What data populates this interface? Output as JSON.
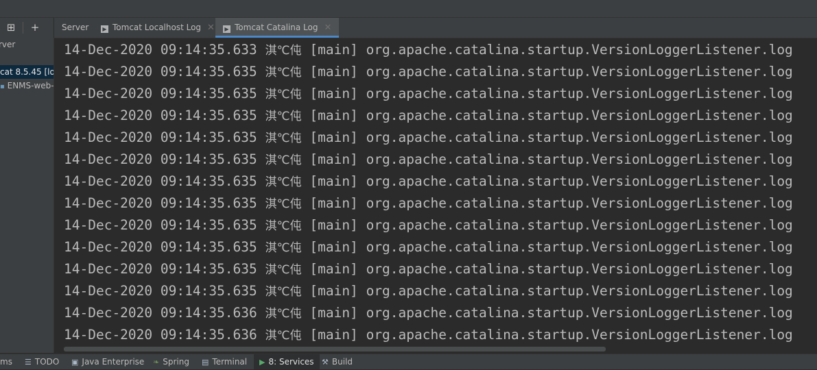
{
  "side_toolbar": {
    "layout_icon": "layout-icon",
    "add_icon": "add-icon"
  },
  "tree": [
    {
      "label": "rver",
      "selected": false
    },
    {
      "label": "cat 8.5.45 [lo",
      "selected": true
    },
    {
      "label": "ENMS-web-",
      "selected": false,
      "icon": "artifact-icon"
    }
  ],
  "tabs": [
    {
      "label": "Server",
      "icon": "",
      "closable": false,
      "active": false
    },
    {
      "label": "Tomcat Localhost Log",
      "icon": "console-icon",
      "closable": true,
      "active": false
    },
    {
      "label": "Tomcat Catalina Log",
      "icon": "console-icon",
      "closable": true,
      "active": true
    }
  ],
  "log": {
    "lines": [
      {
        "date": "14-Dec-2020",
        "time": "09:14:35.633",
        "level": "淇℃伅",
        "thread": "[main]",
        "logger": "org.apache.catalina.startup.VersionLoggerListener.log"
      },
      {
        "date": "14-Dec-2020",
        "time": "09:14:35.635",
        "level": "淇℃伅",
        "thread": "[main]",
        "logger": "org.apache.catalina.startup.VersionLoggerListener.log"
      },
      {
        "date": "14-Dec-2020",
        "time": "09:14:35.635",
        "level": "淇℃伅",
        "thread": "[main]",
        "logger": "org.apache.catalina.startup.VersionLoggerListener.log"
      },
      {
        "date": "14-Dec-2020",
        "time": "09:14:35.635",
        "level": "淇℃伅",
        "thread": "[main]",
        "logger": "org.apache.catalina.startup.VersionLoggerListener.log"
      },
      {
        "date": "14-Dec-2020",
        "time": "09:14:35.635",
        "level": "淇℃伅",
        "thread": "[main]",
        "logger": "org.apache.catalina.startup.VersionLoggerListener.log"
      },
      {
        "date": "14-Dec-2020",
        "time": "09:14:35.635",
        "level": "淇℃伅",
        "thread": "[main]",
        "logger": "org.apache.catalina.startup.VersionLoggerListener.log"
      },
      {
        "date": "14-Dec-2020",
        "time": "09:14:35.635",
        "level": "淇℃伅",
        "thread": "[main]",
        "logger": "org.apache.catalina.startup.VersionLoggerListener.log"
      },
      {
        "date": "14-Dec-2020",
        "time": "09:14:35.635",
        "level": "淇℃伅",
        "thread": "[main]",
        "logger": "org.apache.catalina.startup.VersionLoggerListener.log"
      },
      {
        "date": "14-Dec-2020",
        "time": "09:14:35.635",
        "level": "淇℃伅",
        "thread": "[main]",
        "logger": "org.apache.catalina.startup.VersionLoggerListener.log"
      },
      {
        "date": "14-Dec-2020",
        "time": "09:14:35.635",
        "level": "淇℃伅",
        "thread": "[main]",
        "logger": "org.apache.catalina.startup.VersionLoggerListener.log"
      },
      {
        "date": "14-Dec-2020",
        "time": "09:14:35.635",
        "level": "淇℃伅",
        "thread": "[main]",
        "logger": "org.apache.catalina.startup.VersionLoggerListener.log"
      },
      {
        "date": "14-Dec-2020",
        "time": "09:14:35.635",
        "level": "淇℃伅",
        "thread": "[main]",
        "logger": "org.apache.catalina.startup.VersionLoggerListener.log"
      },
      {
        "date": "14-Dec-2020",
        "time": "09:14:35.636",
        "level": "淇℃伅",
        "thread": "[main]",
        "logger": "org.apache.catalina.startup.VersionLoggerListener.log"
      },
      {
        "date": "14-Dec-2020",
        "time": "09:14:35.636",
        "level": "淇℃伅",
        "thread": "[main]",
        "logger": "org.apache.catalina.startup.VersionLoggerListener.log"
      }
    ]
  },
  "bottom_tabs": [
    {
      "label": "ms",
      "icon": "",
      "active": false
    },
    {
      "label": "TODO",
      "icon": "todo-icon",
      "active": false
    },
    {
      "label": "Java Enterprise",
      "icon": "java-enterprise-icon",
      "active": false
    },
    {
      "label": "Spring",
      "icon": "spring-icon",
      "active": false
    },
    {
      "label": "Terminal",
      "icon": "terminal-icon",
      "active": false
    },
    {
      "label": "8: Services",
      "icon": "services-icon",
      "active": true
    },
    {
      "label": "Build",
      "icon": "build-icon",
      "active": false
    }
  ],
  "colors": {
    "background": "#2b2b2b",
    "panel": "#3c3f41",
    "text": "#bbbbbb",
    "accent": "#4a88c7",
    "selection": "#0d293e"
  }
}
